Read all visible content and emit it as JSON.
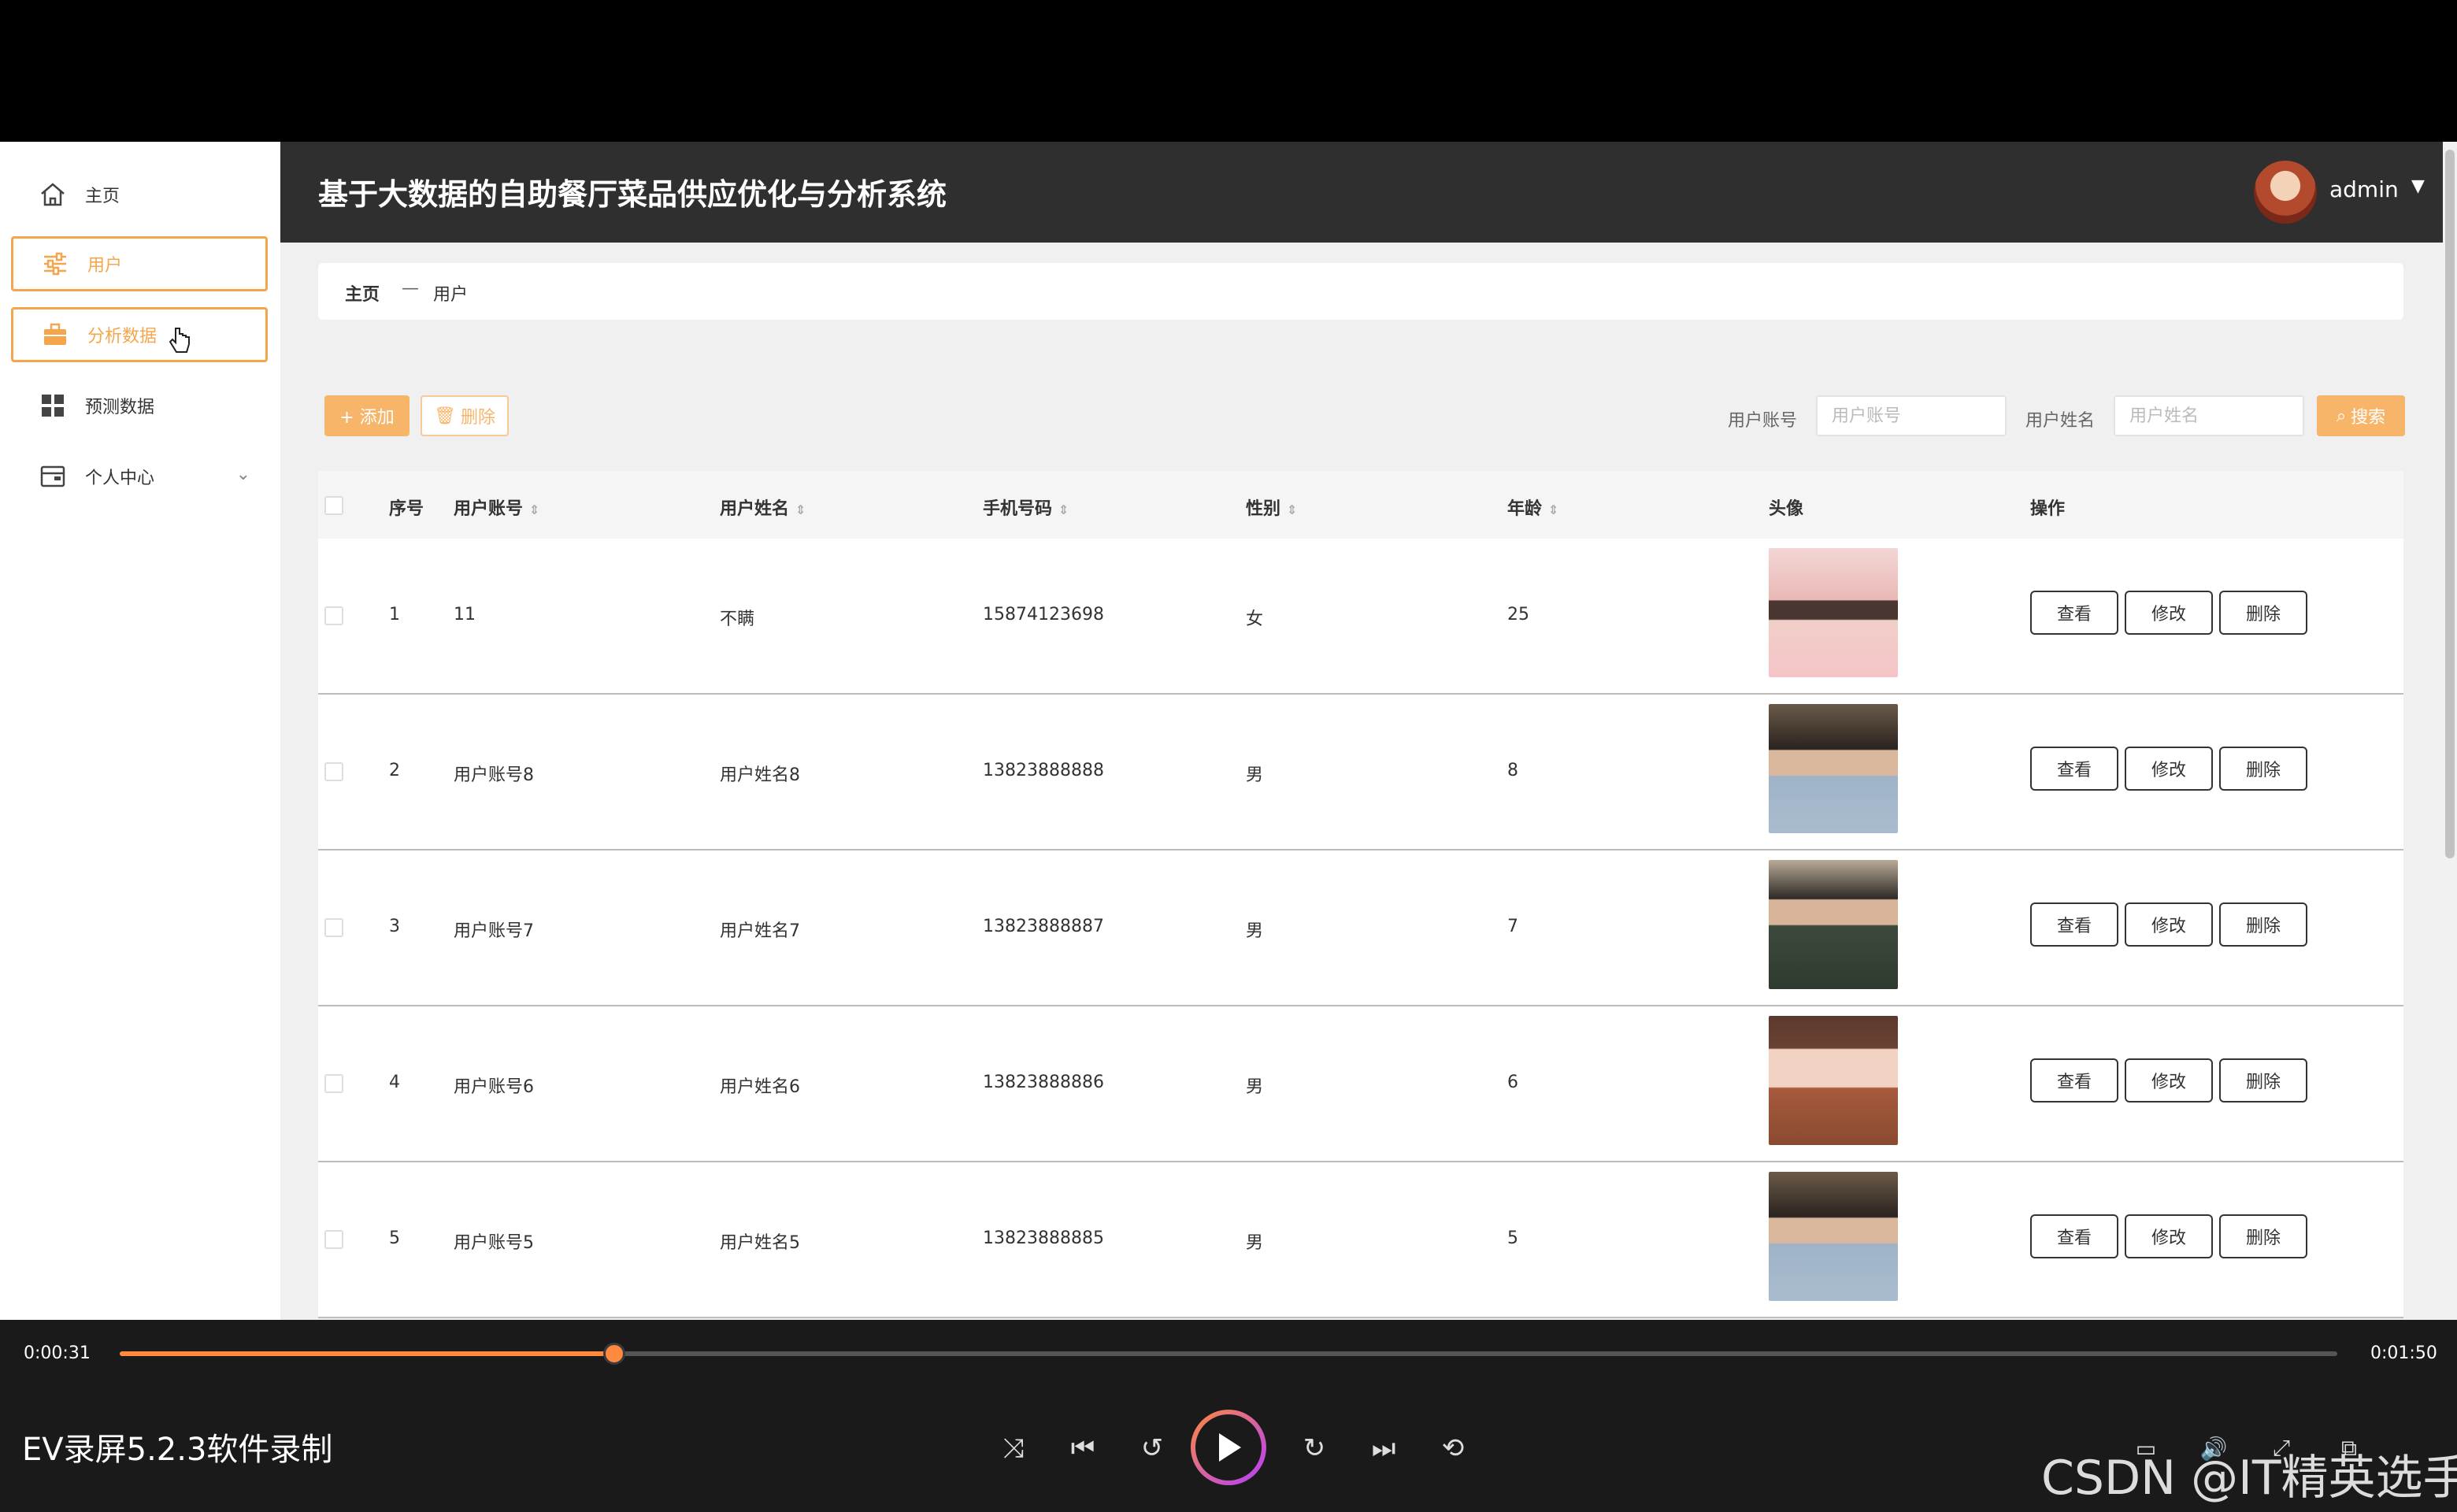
{
  "app": {
    "title": "基于大数据的自助餐厅菜品供应优化与分析系统",
    "user": "admin"
  },
  "sidebar": {
    "items": [
      {
        "label": "主页"
      },
      {
        "label": "用户"
      },
      {
        "label": "分析数据"
      },
      {
        "label": "预测数据"
      },
      {
        "label": "个人中心"
      }
    ]
  },
  "breadcrumb": {
    "home": "主页",
    "separator": "—",
    "current": "用户"
  },
  "toolbar": {
    "add_label": "+ 添加",
    "delete_label": "删除",
    "search_label": "搜索",
    "filters": [
      {
        "label": "用户账号",
        "placeholder": "用户账号"
      },
      {
        "label": "用户姓名",
        "placeholder": "用户姓名"
      }
    ]
  },
  "table": {
    "headers": [
      "序号",
      "用户账号",
      "用户姓名",
      "手机号码",
      "性别",
      "年龄",
      "头像",
      "操作"
    ],
    "actions": [
      "查看",
      "修改",
      "删除"
    ],
    "rows": [
      {
        "index": "1",
        "account": "11",
        "name": "不瞒",
        "phone": "15874123698",
        "gender": "女",
        "age": "25"
      },
      {
        "index": "2",
        "account": "用户账号8",
        "name": "用户姓名8",
        "phone": "13823888888",
        "gender": "男",
        "age": "8"
      },
      {
        "index": "3",
        "account": "用户账号7",
        "name": "用户姓名7",
        "phone": "13823888887",
        "gender": "男",
        "age": "7"
      },
      {
        "index": "4",
        "account": "用户账号6",
        "name": "用户姓名6",
        "phone": "13823888886",
        "gender": "男",
        "age": "6"
      },
      {
        "index": "5",
        "account": "用户账号5",
        "name": "用户姓名5",
        "phone": "13823888885",
        "gender": "男",
        "age": "5"
      }
    ]
  },
  "player": {
    "current_time": "0:00:31",
    "total_time": "0:01:50",
    "progress": 0.223,
    "title": "EV录屏5.2.3软件录制",
    "watermark": "CSDN @IT精英选手",
    "accent": "#ff8a3d"
  }
}
